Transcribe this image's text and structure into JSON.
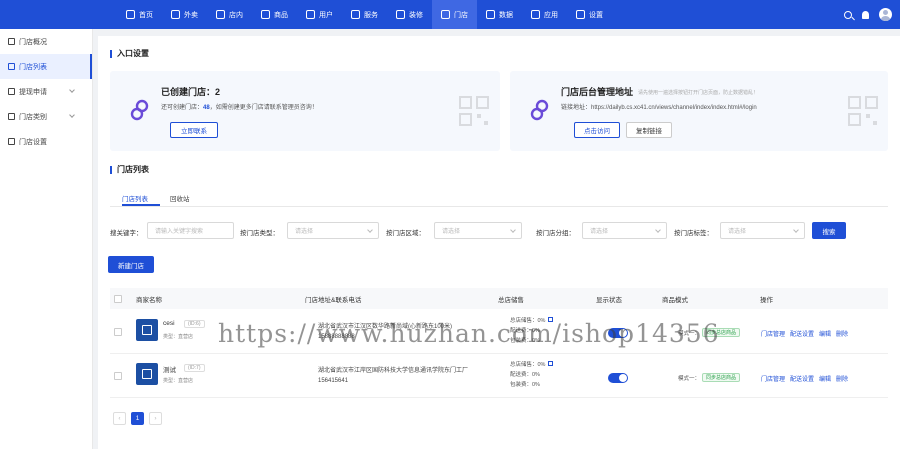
{
  "topnav": {
    "items": [
      {
        "label": "首页",
        "icon": "home-icon"
      },
      {
        "label": "外卖",
        "icon": "fork-icon"
      },
      {
        "label": "店内",
        "icon": "store-icon"
      },
      {
        "label": "商品",
        "icon": "goods-icon"
      },
      {
        "label": "用户",
        "icon": "user-icon"
      },
      {
        "label": "服务",
        "icon": "service-icon"
      },
      {
        "label": "装修",
        "icon": "decorate-icon"
      },
      {
        "label": "门店",
        "icon": "shop-icon"
      },
      {
        "label": "数据",
        "icon": "data-icon"
      },
      {
        "label": "应用",
        "icon": "app-icon"
      },
      {
        "label": "设置",
        "icon": "settings-icon"
      }
    ],
    "active_index": 7
  },
  "sidebar": {
    "items": [
      {
        "label": "门店概况",
        "icon": "chart-icon"
      },
      {
        "label": "门店列表",
        "icon": "list-icon"
      },
      {
        "label": "提现申请",
        "icon": "withdraw-icon"
      },
      {
        "label": "门店类别",
        "icon": "category-icon"
      },
      {
        "label": "门店设置",
        "icon": "gear-icon"
      }
    ],
    "active_index": 1
  },
  "entry": {
    "section_title": "入口设置",
    "created": {
      "title": "已创建门店：2",
      "sub_prefix": "还可创建门店：",
      "sub_count": "48",
      "sub_suffix": "，如需创建更多门店请联系管理员咨询！",
      "button": "立即联系"
    },
    "admin": {
      "title": "门店后台管理地址",
      "note": "请先使用一遍选择按钮打开门店页面，防止数据错乱！",
      "address": "链接地址：https://dailyb.cs.xc41.cn/views/channel/index/index.html#/login",
      "visit_button": "点击访问",
      "copy_button": "复制链接"
    }
  },
  "list": {
    "section_title": "门店列表",
    "tabs": [
      "门店列表",
      "回收站"
    ],
    "filters": [
      {
        "label": "搜关键字：",
        "placeholder": "请输入关键字搜索"
      },
      {
        "label": "按门店类型：",
        "placeholder": "请选择"
      },
      {
        "label": "按门店区域：",
        "placeholder": "请选择"
      },
      {
        "label": "按门店分组：",
        "placeholder": "请选择"
      },
      {
        "label": "按门店标签：",
        "placeholder": "请选择"
      }
    ],
    "search_button": "搜索",
    "add_button": "新建门店",
    "columns": [
      "商家名称",
      "门店地址&联系电话",
      "总店储售",
      "显示状态",
      "商品模式",
      "操作"
    ],
    "rows": [
      {
        "name": "cesi",
        "id": "(ID:6)",
        "type": "类型：直营店",
        "address": "湖北省武汉市江汉区数华路新尚域(心新路东100米)",
        "phone": "15888888888",
        "stock_total": "总店储售：0%",
        "stock_delivery": "配送费：0%",
        "stock_pack": "包装费：0%",
        "mode_label": "模式一：",
        "mode_tag": "同步总店商品",
        "ops": [
          "门店管理",
          "配送设置",
          "编辑",
          "删除"
        ]
      },
      {
        "name": "测试",
        "id": "(ID:7)",
        "type": "类型：直营店",
        "address": "湖北省武汉市江岸区国防科技大学信息通讯学院东门工厂",
        "phone": "156415641",
        "stock_total": "总店储售：0%",
        "stock_delivery": "配送费：0%",
        "stock_pack": "包装费：0%",
        "mode_label": "模式一：",
        "mode_tag": "同步总店商品",
        "ops": [
          "门店管理",
          "配送设置",
          "编辑",
          "删除"
        ]
      }
    ],
    "pagination": {
      "prev": "‹",
      "current": "1",
      "next": "›"
    }
  },
  "watermark": "https://www.huzhan.com/ishop14356",
  "colors": {
    "brand": "#1f4fd6",
    "nav_active": "#3f68e3",
    "tag_green": "#2aa04a"
  }
}
